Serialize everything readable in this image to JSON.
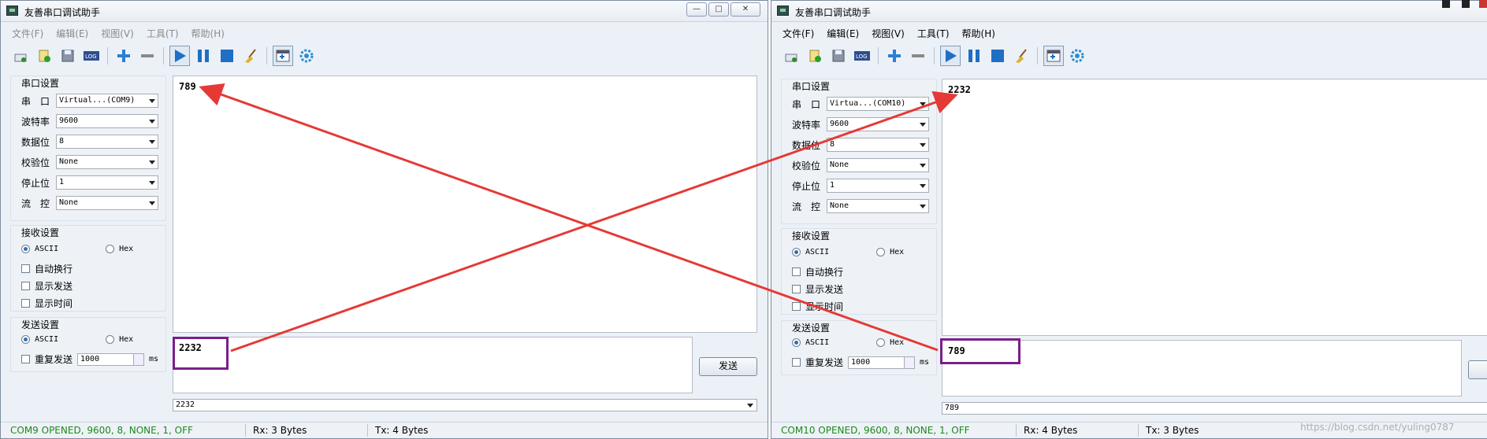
{
  "left_window": {
    "title": "友善串口调试助手",
    "window_buttons": [
      "—",
      "□",
      "✕"
    ],
    "menu": [
      "文件(F)",
      "编辑(E)",
      "视图(V)",
      "工具(T)",
      "帮助(H)"
    ],
    "toolbar_icons": [
      "new-icon",
      "open-icon",
      "save-icon",
      "log-icon",
      "add-icon",
      "remove-icon",
      "play-icon",
      "pause-icon",
      "stop-icon",
      "clear-broom-icon",
      "window-layout-icon",
      "settings-gear-icon"
    ],
    "serial": {
      "group_title": "串口设置",
      "port_label": "串　口",
      "port_value": "Virtual...(COM9)",
      "baud_label": "波特率",
      "baud_value": "9600",
      "databits_label": "数据位",
      "databits_value": "8",
      "parity_label": "校验位",
      "parity_value": "None",
      "stopbits_label": "停止位",
      "stopbits_value": "1",
      "flow_label": "流　控",
      "flow_value": "None"
    },
    "receive": {
      "group_title": "接收设置",
      "ascii_label": "ASCII",
      "hex_label": "Hex",
      "auto_wrap": "自动换行",
      "show_send": "显示发送",
      "show_time": "显示时间"
    },
    "send": {
      "group_title": "发送设置",
      "ascii_label": "ASCII",
      "hex_label": "Hex",
      "repeat_label": "重复发送",
      "interval": "1000",
      "unit": "ms",
      "send_button": "发送"
    },
    "rx_text": "789",
    "tx_text": "2232",
    "history_value": "2232",
    "status": {
      "port": "COM9 OPENED, 9600, 8, NONE, 1, OFF",
      "rx": "Rx: 3 Bytes",
      "tx": "Tx: 4 Bytes"
    }
  },
  "right_window": {
    "title": "友善串口调试助手",
    "menu": [
      "文件(F)",
      "编辑(E)",
      "视图(V)",
      "工具(T)",
      "帮助(H)"
    ],
    "serial": {
      "group_title": "串口设置",
      "port_label": "串　口",
      "port_value": "Virtua...(COM10)",
      "baud_label": "波特率",
      "baud_value": "9600",
      "databits_label": "数据位",
      "databits_value": "8",
      "parity_label": "校验位",
      "parity_value": "None",
      "stopbits_label": "停止位",
      "stopbits_value": "1",
      "flow_label": "流　控",
      "flow_value": "None"
    },
    "receive": {
      "group_title": "接收设置",
      "ascii_label": "ASCII",
      "hex_label": "Hex",
      "auto_wrap": "自动换行",
      "show_send": "显示发送",
      "show_time": "显示时间"
    },
    "send": {
      "group_title": "发送设置",
      "ascii_label": "ASCII",
      "hex_label": "Hex",
      "repeat_label": "重复发送",
      "interval": "1000",
      "unit": "ms"
    },
    "rx_text": "2232",
    "tx_text": "789",
    "history_value": "789",
    "status": {
      "port": "COM10 OPENED, 9600, 8, NONE, 1, OFF",
      "rx": "Rx: 4 Bytes",
      "tx": "Tx: 3 Bytes"
    }
  },
  "watermark": "https://blog.csdn.net/yuling0787",
  "colors": {
    "accent_arrow": "#e53935",
    "highlight_box": "#7a1f8a",
    "status_green": "#1a8a1a"
  }
}
